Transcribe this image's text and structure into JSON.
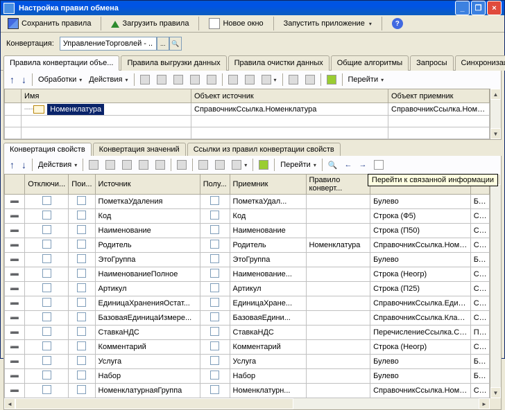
{
  "window": {
    "title": "Настройка правил обмена"
  },
  "main_toolbar": {
    "save": "Сохранить правила",
    "load": "Загрузить правила",
    "new_window": "Новое окно",
    "run_app": "Запустить приложение"
  },
  "conversion": {
    "label": "Конвертация:",
    "value": "УправлениеТорговлей - ...",
    "btn": "..."
  },
  "tabs": {
    "t0": "Правила конвертации объе...",
    "t1": "Правила выгрузки данных",
    "t2": "Правила очистки данных",
    "t3": "Общие алгоритмы",
    "t4": "Запросы",
    "t5": "Синхронизация"
  },
  "inner_tb": {
    "processing": "Обработки",
    "actions": "Действия",
    "goto": "Перейти"
  },
  "top_grid": {
    "cols": {
      "name": "Имя",
      "src": "Объект источник",
      "dst": "Объект приемник"
    },
    "row": {
      "name": "Номенклатура",
      "src": "СправочникСсылка.Номенклатура",
      "dst": "СправочникСсылка.Номенклатура"
    }
  },
  "sub_tabs": {
    "s0": "Конвертация свойств",
    "s1": "Конвертация значений",
    "s2": "Ссылки из правил конвертации свойств"
  },
  "prop_tb": {
    "actions": "Действия",
    "goto": "Перейти"
  },
  "tooltip": "Перейти к связанной информации",
  "prop_grid": {
    "cols": {
      "off": "Отключи...",
      "poi": "Пои...",
      "src": "Источник",
      "get": "Полу...",
      "dst": "Приемник",
      "rule": "Правило конверт...",
      "type": "",
      "st": ""
    },
    "rows": [
      {
        "src": "ПометкаУдаления",
        "dst": "ПометкаУдал...",
        "rule": "",
        "type": "Булево",
        "st": "Бу..."
      },
      {
        "src": "Код",
        "dst": "Код",
        "rule": "",
        "type": "Строка (Ф5)",
        "st": "Ст..."
      },
      {
        "src": "Наименование",
        "dst": "Наименование",
        "rule": "",
        "type": "Строка (П50)",
        "st": "Ст..."
      },
      {
        "src": "Родитель",
        "dst": "Родитель",
        "rule": "Номенклатура",
        "type": "СправочникСсылка.Номенк...",
        "st": "Сп..."
      },
      {
        "src": "ЭтоГруппа",
        "dst": "ЭтоГруппа",
        "rule": "",
        "type": "Булево",
        "st": "Бу..."
      },
      {
        "src": "НаименованиеПолное",
        "dst": "Наименование...",
        "rule": "",
        "type": "Строка (Неогр)",
        "st": "Ст..."
      },
      {
        "src": "Артикул",
        "dst": "Артикул",
        "rule": "",
        "type": "Строка (П25)",
        "st": "Ст..."
      },
      {
        "src": "ЕдиницаХраненияОстат...",
        "dst": "ЕдиницаХране...",
        "rule": "",
        "type": "СправочникСсылка.Единиц...",
        "st": "Сп..."
      },
      {
        "src": "БазоваяЕдиницаИзмере...",
        "dst": "БазоваяЕдини...",
        "rule": "",
        "type": "СправочникСсылка.Класси...",
        "st": "Сп..."
      },
      {
        "src": "СтавкаНДС",
        "dst": "СтавкаНДС",
        "rule": "",
        "type": "ПеречислениеСсылка.Став...",
        "st": "Пе..."
      },
      {
        "src": "Комментарий",
        "dst": "Комментарий",
        "rule": "",
        "type": "Строка (Неогр)",
        "st": "Ст..."
      },
      {
        "src": "Услуга",
        "dst": "Услуга",
        "rule": "",
        "type": "Булево",
        "st": "Бу..."
      },
      {
        "src": "Набор",
        "dst": "Набор",
        "rule": "",
        "type": "Булево",
        "st": "Бу..."
      },
      {
        "src": "НоменклатурнаяГруппа",
        "dst": "Номенклатурн...",
        "rule": "",
        "type": "СправочникСсылка.Номенк...",
        "st": "Сп..."
      }
    ]
  }
}
